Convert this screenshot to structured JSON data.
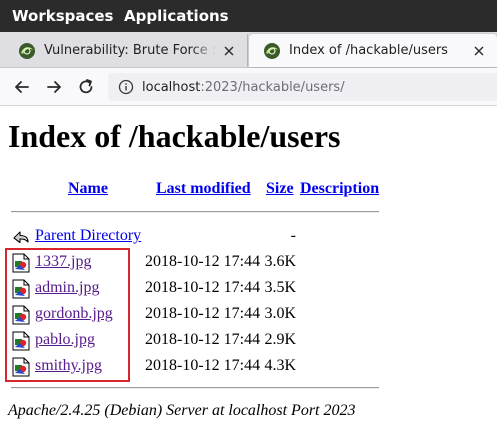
{
  "system_bar": {
    "workspaces_label": "Workspaces",
    "applications_label": "Applications"
  },
  "tabs": [
    {
      "label": "Vulnerability: Brute Force :: Damn Vulnerable Web Application",
      "icon": "dvwa-favicon",
      "active": false
    },
    {
      "label": "Index of /hackable/users",
      "icon": "dvwa-favicon",
      "active": true
    }
  ],
  "navbar": {
    "url_host": "localhost",
    "url_rest": ":2023/hackable/users/"
  },
  "page": {
    "title": "Index of /hackable/users",
    "columns": {
      "name": "Name",
      "last_modified": "Last modified",
      "size": "Size",
      "description": "Description"
    },
    "parent": {
      "label": "Parent Directory",
      "size": "-",
      "icon": "back-arrow-icon"
    },
    "files": [
      {
        "name": "1337.jpg",
        "modified": "2018-10-12 17:44",
        "size": "3.6K",
        "icon": "image-file-icon"
      },
      {
        "name": "admin.jpg",
        "modified": "2018-10-12 17:44",
        "size": "3.5K",
        "icon": "image-file-icon"
      },
      {
        "name": "gordonb.jpg",
        "modified": "2018-10-12 17:44",
        "size": "3.0K",
        "icon": "image-file-icon"
      },
      {
        "name": "pablo.jpg",
        "modified": "2018-10-12 17:44",
        "size": "2.9K",
        "icon": "image-file-icon"
      },
      {
        "name": "smithy.jpg",
        "modified": "2018-10-12 17:44",
        "size": "4.3K",
        "icon": "image-file-icon"
      }
    ],
    "footer": "Apache/2.4.25 (Debian) Server at localhost Port 2023"
  },
  "colors": {
    "link": "#0000ee",
    "visited_link": "#551a8b",
    "highlight_box": "#d9252b",
    "topbar": "#2b2b2b"
  }
}
